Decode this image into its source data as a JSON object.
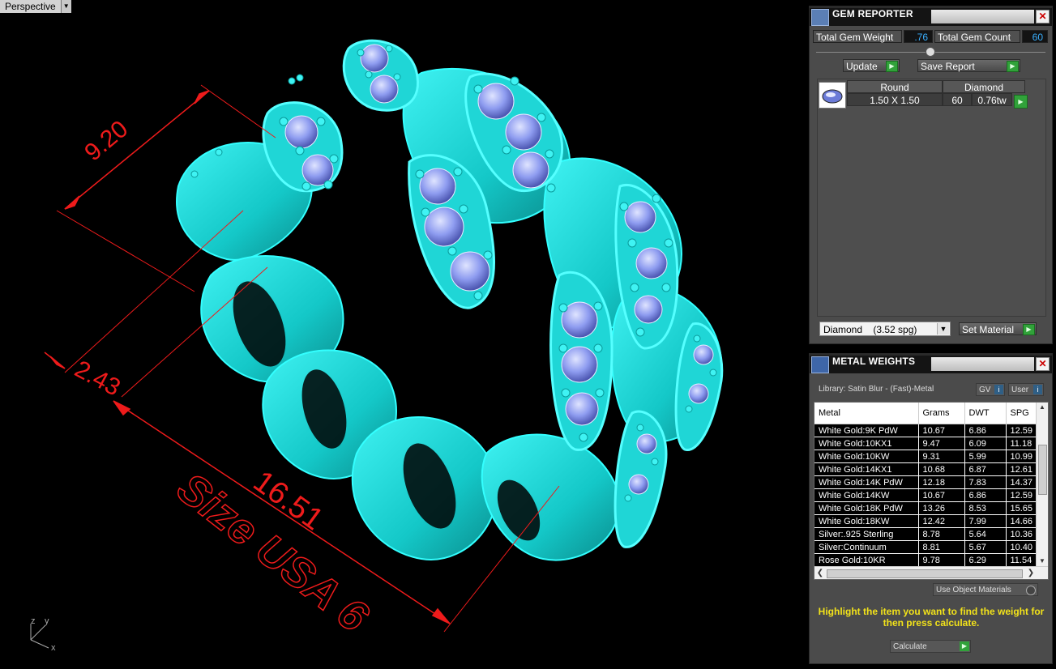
{
  "viewport": {
    "tab_label": "Perspective",
    "tab_dropdown_icon": "triangle-down",
    "dimensions": [
      "9.20",
      "2.43",
      "16.51"
    ],
    "engraving": "Size USA 6",
    "axis_labels": {
      "z": "z",
      "y": "y",
      "x": "x"
    },
    "colors": {
      "model": "#19e0e0",
      "dimension": "#ee1b1b",
      "gem": "#8e9cf0"
    }
  },
  "gem_reporter": {
    "title": "GEM REPORTER",
    "close_icon": "close-x",
    "total_gem_weight_label": "Total Gem Weight",
    "total_gem_weight_value": ".76",
    "total_gem_count_label": "Total Gem Count",
    "total_gem_count_value": "60",
    "update_label": "Update",
    "save_report_label": "Save Report",
    "gem_list": {
      "headers": [
        "Round",
        "Diamond"
      ],
      "row": {
        "size": "1.50 X 1.50",
        "count": "60",
        "weight": "0.76tw"
      }
    },
    "material_select": "Diamond    (3.52 spg)",
    "set_material_label": "Set Material"
  },
  "metal_weights": {
    "title": "METAL WEIGHTS",
    "library_label": "Library: Satin Blur - (Fast)-Metal",
    "gv_label": "GV",
    "user_label": "User",
    "columns": [
      "Metal",
      "Grams",
      "DWT",
      "SPG"
    ],
    "rows": [
      [
        "White Gold:9K PdW",
        "10.67",
        "6.86",
        "12.59"
      ],
      [
        "White Gold:10KX1",
        "9.47",
        "6.09",
        "11.18"
      ],
      [
        "White Gold:10KW",
        "9.31",
        "5.99",
        "10.99"
      ],
      [
        "White Gold:14KX1",
        "10.68",
        "6.87",
        "12.61"
      ],
      [
        "White Gold:14K PdW",
        "12.18",
        "7.83",
        "14.37"
      ],
      [
        "White Gold:14KW",
        "10.67",
        "6.86",
        "12.59"
      ],
      [
        "White Gold:18K PdW",
        "13.26",
        "8.53",
        "15.65"
      ],
      [
        "White Gold:18KW",
        "12.42",
        "7.99",
        "14.66"
      ],
      [
        "Silver:.925 Sterling",
        "8.78",
        "5.64",
        "10.36"
      ],
      [
        "Silver:Continuum",
        "8.81",
        "5.67",
        "10.40"
      ],
      [
        "Rose Gold:10KR",
        "9.78",
        "6.29",
        "11.54"
      ]
    ],
    "use_object_materials_label": "Use Object Materials",
    "hint": "Highlight the item you want to find the weight for then press calculate.",
    "calculate_label": "Calculate"
  }
}
